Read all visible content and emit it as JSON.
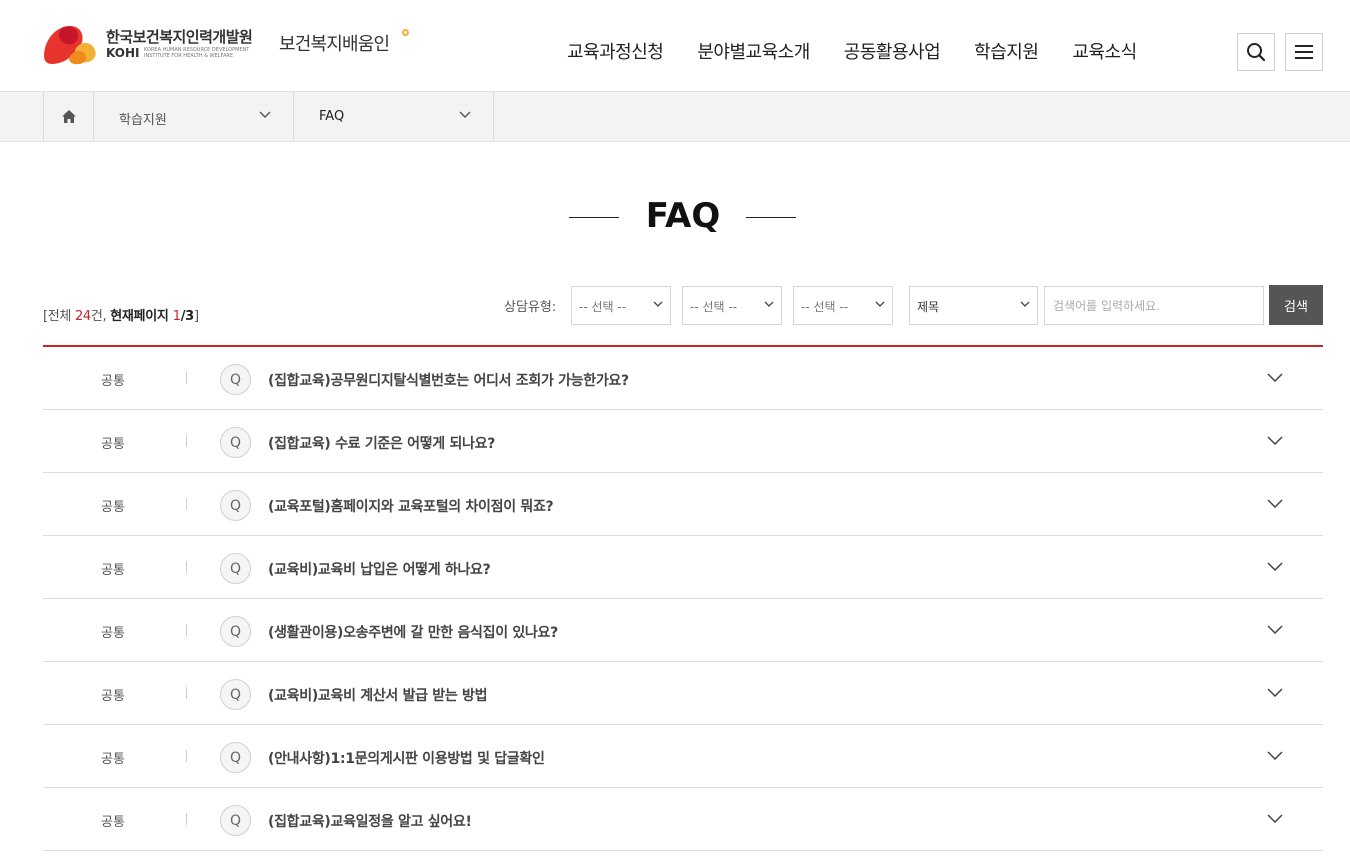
{
  "header": {
    "org_name": "한국보건복지인력개발원",
    "org_abbr": "KOHI",
    "org_eng": "KOREA HUMAN RESOURCE DEVELOPMENT INSTITUTE FOR HEALTH & WELFARE",
    "service_name": "보건복지배움인",
    "nav": [
      {
        "label": "교육과정신청"
      },
      {
        "label": "분야별교육소개"
      },
      {
        "label": "공동활용사업"
      },
      {
        "label": "학습지원"
      },
      {
        "label": "교육소식"
      }
    ],
    "icons": {
      "search": "search-icon",
      "menu": "hamburger-menu-icon"
    }
  },
  "breadcrumb": {
    "home_icon": "home-icon",
    "level1": "학습지원",
    "level2": "FAQ"
  },
  "page": {
    "title": "FAQ"
  },
  "summary": {
    "prefix": "[전체 ",
    "total": "24",
    "unit": "건, ",
    "current_label": "현재페이지 ",
    "current_page": "1",
    "page_sep": "/3",
    "suffix": "]"
  },
  "search": {
    "category_label": "상담유형:",
    "select1": "-- 선택 --",
    "select2": "-- 선택 --",
    "select3": "-- 선택 --",
    "field": "제목",
    "placeholder": "검색어를 입력하세요.",
    "button": "검색"
  },
  "faq": {
    "q_badge": "Q",
    "items": [
      {
        "category": "공통",
        "question": "(집합교육)공무원디지탈식별번호는 어디서 조회가 가능한가요?"
      },
      {
        "category": "공통",
        "question": "(집합교육) 수료 기준은 어떻게 되나요?"
      },
      {
        "category": "공통",
        "question": "(교육포털)홈페이지와 교육포털의 차이점이 뭐죠?"
      },
      {
        "category": "공통",
        "question": "(교육비)교육비 납입은 어떻게 하나요?"
      },
      {
        "category": "공통",
        "question": "(생활관이용)오송주변에 갈 만한 음식집이 있나요?"
      },
      {
        "category": "공통",
        "question": "(교육비)교육비 계산서 발급 받는 방법"
      },
      {
        "category": "공통",
        "question": "(안내사항)1:1문의게시판 이용방법 및 답글확인"
      },
      {
        "category": "공통",
        "question": "(집합교육)교육일정을 알고 싶어요!"
      }
    ]
  },
  "colors": {
    "accent_red": "#c1272d",
    "button_dark": "#555555",
    "logo_red": "#e8342c",
    "logo_yellow": "#f2b134"
  }
}
